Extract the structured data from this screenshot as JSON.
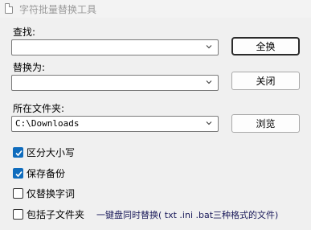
{
  "window": {
    "title": "字符批量替换工具"
  },
  "find": {
    "label": "查找:",
    "value": ""
  },
  "replace": {
    "label": "替换为:",
    "value": ""
  },
  "folder": {
    "label": "所在文件夹:",
    "value": "C:\\Downloads"
  },
  "buttons": {
    "replace_all": "全换",
    "close": "关闭",
    "browse": "浏览"
  },
  "options": [
    {
      "label": "区分大小写",
      "checked": true
    },
    {
      "label": "保存备份",
      "checked": true
    },
    {
      "label": "仅替换字词",
      "checked": false
    },
    {
      "label": "包括子文件夹",
      "checked": false
    }
  ],
  "note": "一键盘同时替换( txt .ini .bat三种格式的文件)",
  "colors": {
    "accent": "#0f6cbd",
    "background": "#f0f0f0"
  }
}
